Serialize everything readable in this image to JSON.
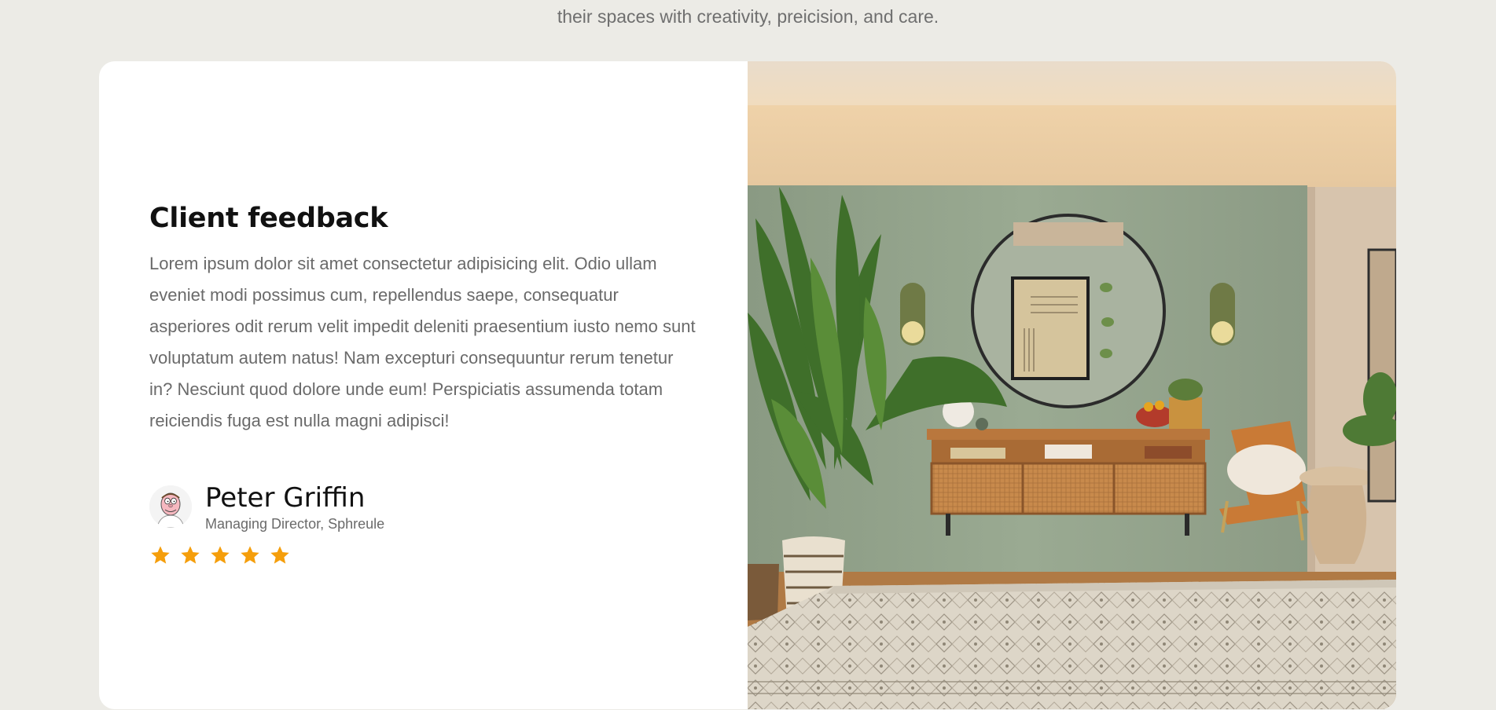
{
  "section": {
    "intro_text": "their spaces with creativity, preicision, and care."
  },
  "feedback": {
    "heading": "Client feedback",
    "quote": "Lorem ipsum dolor sit amet consectetur adipisicing elit. Odio ullam eveniet modi possimus cum, repellendus saepe, consequatur asperiores odit rerum velit impedit deleniti praesentium iusto nemo sunt voluptatum autem natus! Nam excepturi consequuntur rerum tenetur in? Nesciunt quod dolore unde eum! Perspiciatis assumenda totam reiciendis fuga est nulla magni adipisci!",
    "author": {
      "name": "Peter Griffin",
      "role": "Managing Director, Sphreule",
      "avatar_icon": "avatar-icon"
    },
    "rating": {
      "value": 5,
      "max": 5,
      "icon": "star-icon"
    }
  },
  "colors": {
    "page_background": "#ecebe6",
    "card_background": "#ffffff",
    "star": "#f59e0b",
    "text_muted": "#6a6a6a",
    "heading": "#111111"
  },
  "image": {
    "subject": "room-photo"
  }
}
